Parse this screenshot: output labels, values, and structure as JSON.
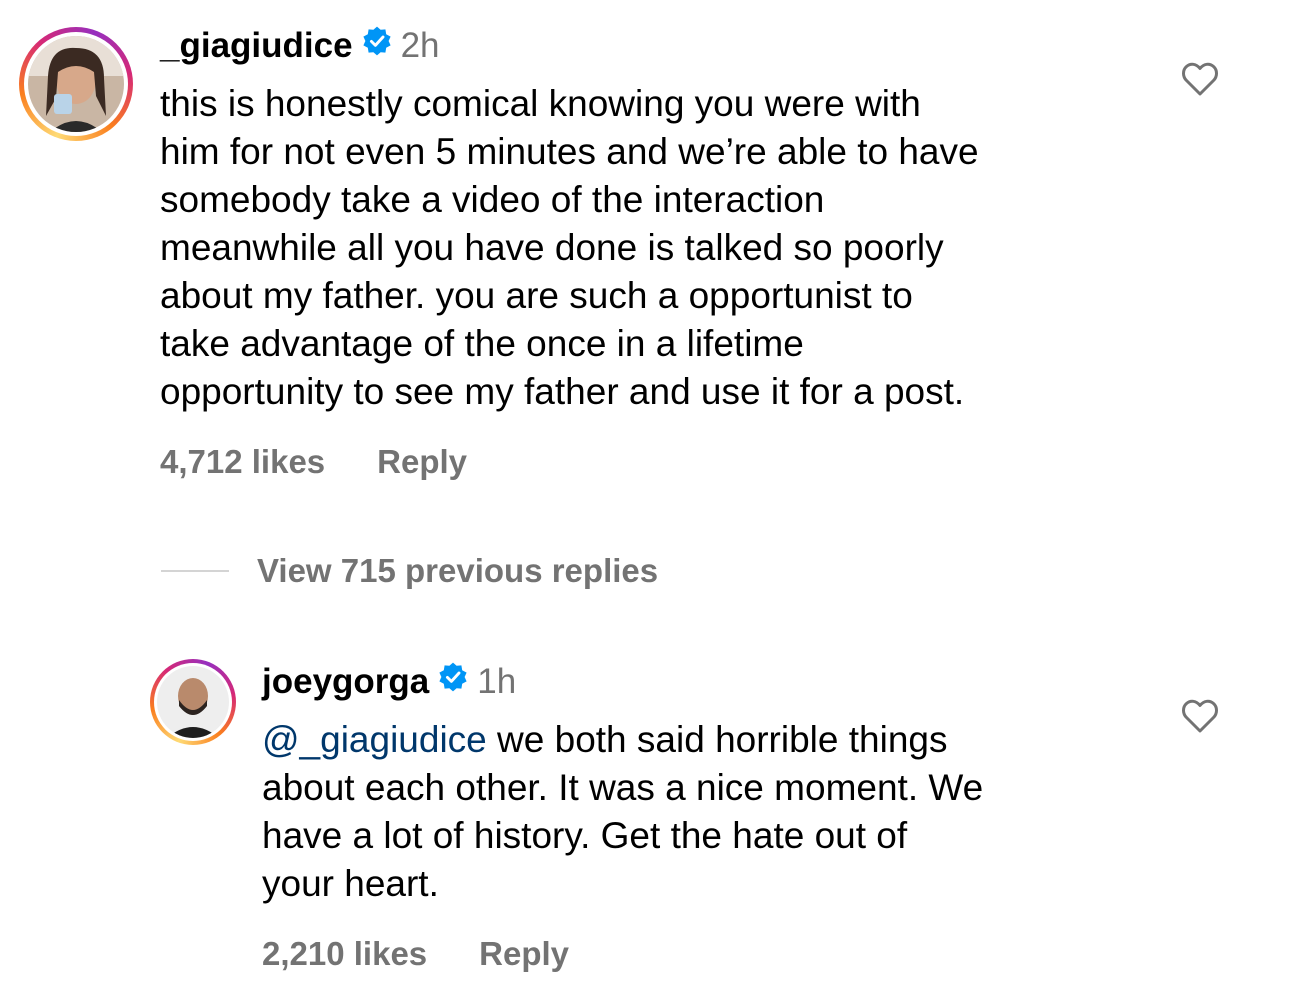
{
  "comments": [
    {
      "username": "_giagiudice",
      "time": "2h",
      "text": "this is honestly comical knowing you were with\nhim for not even 5 minutes and we’re able to have\nsomebody take a video of the interaction\nmeanwhile all you have done is talked so poorly\nabout my father. you are such a opportunist to\ntake advantage of the once in a lifetime\nopportunity to see my father and use it for a post.",
      "likes": "4,712 likes",
      "reply_label": "Reply",
      "icons": {
        "verified": "verified-badge-icon",
        "like": "heart-outline-icon"
      }
    },
    {
      "username": "joeygorga",
      "time": "1h",
      "mention": "@_giagiudice",
      "text": " we both said horrible things\nabout each other. It was a nice moment. We\nhave a lot of history. Get the hate out of\nyour heart.",
      "likes": "2,210 likes",
      "reply_label": "Reply",
      "icons": {
        "verified": "verified-badge-icon",
        "like": "heart-outline-icon"
      }
    }
  ],
  "view_replies": {
    "label": "View 715 previous replies"
  },
  "colors": {
    "verified_blue": "#0095f6",
    "mention_blue": "#00376b",
    "secondary_text": "#737373"
  }
}
